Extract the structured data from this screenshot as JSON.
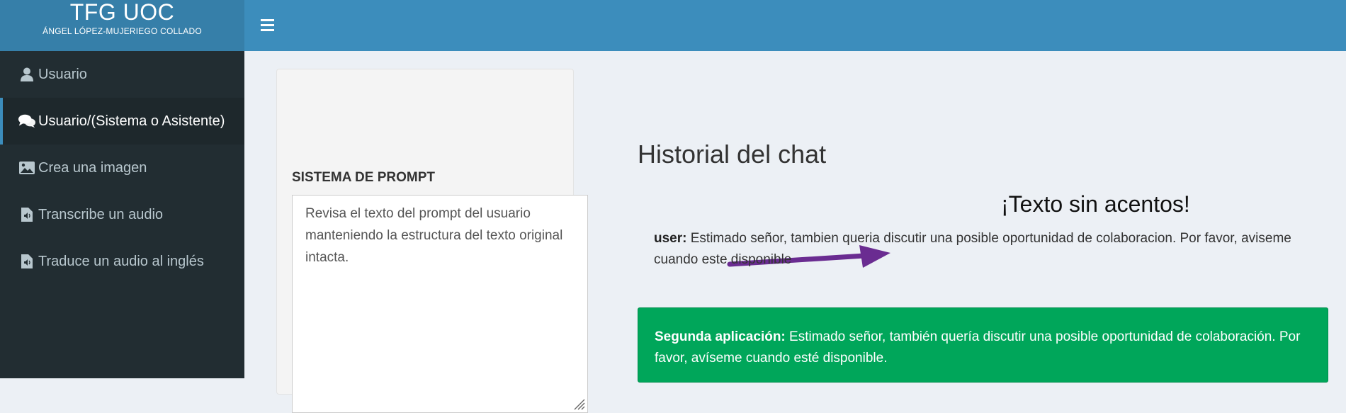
{
  "header": {
    "title": "TFG UOC",
    "subtitle": "ÁNGEL LÓPEZ-MUJERIEGO COLLADO"
  },
  "sidebar": {
    "items": [
      {
        "label": "Usuario",
        "icon": "user-icon",
        "active": false
      },
      {
        "label": "Usuario/(Sistema o Asistente)",
        "icon": "comments-icon",
        "active": true
      },
      {
        "label": "Crea una imagen",
        "icon": "image-icon",
        "active": false
      },
      {
        "label": "Transcribe un audio",
        "icon": "audio-file-icon",
        "active": false
      },
      {
        "label": "Traduce un audio al inglés",
        "icon": "audio-file-icon",
        "active": false
      }
    ]
  },
  "prompt_panel": {
    "label": "SISTEMA DE PROMPT",
    "text": "Revisa el texto del prompt del usuario manteniendo la estructura del texto original intacta."
  },
  "chat": {
    "title": "Historial del chat",
    "annotation": "¡Texto sin acentos!",
    "user_label": "user:",
    "user_text": "Estimado señor, tambien queria discutir una posible oportunidad de colaboracion. Por favor, aviseme cuando este disponible",
    "result_label": "Segunda aplicación:",
    "result_text": "Estimado señor, también quería discutir una posible oportunidad de colaboración. Por favor, avíseme cuando esté disponible."
  },
  "colors": {
    "logo_bg": "#367fa9",
    "navbar_bg": "#3c8dbc",
    "sidebar_bg": "#222d32",
    "success_bg": "#00a65a",
    "arrow": "#6a2c91"
  }
}
